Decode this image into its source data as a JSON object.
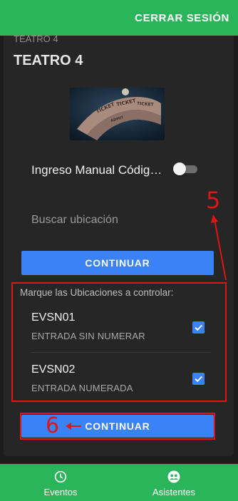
{
  "header": {
    "logout_label": "CERRAR SESIÓN"
  },
  "event": {
    "subtitle": "TEATRO 4",
    "title": "TEATRO 4"
  },
  "manual_entry": {
    "label": "Ingreso Manual Códig…",
    "enabled": false
  },
  "search": {
    "placeholder": "Buscar ubicación",
    "value": ""
  },
  "continue_top_label": "CONTINUAR",
  "locations": {
    "header": "Marque las Ubicaciones a controlar:",
    "items": [
      {
        "code": "EVSN01",
        "description": "ENTRADA SIN NUMERAR",
        "checked": true
      },
      {
        "code": "EVSN02",
        "description": "ENTRADA NUMERADA",
        "checked": true
      }
    ]
  },
  "continue_bottom_label": "CONTINUAR",
  "annotations": {
    "marker_5": "5",
    "marker_6": "6"
  },
  "bottom_nav": [
    {
      "label": "Eventos",
      "icon": "clock-icon"
    },
    {
      "label": "Asistentes",
      "icon": "users-icon"
    }
  ],
  "colors": {
    "brand_green": "#2bb55a",
    "primary_blue": "#3b82f6",
    "annotation_red": "#e01515",
    "background": "#1c1c1c"
  }
}
